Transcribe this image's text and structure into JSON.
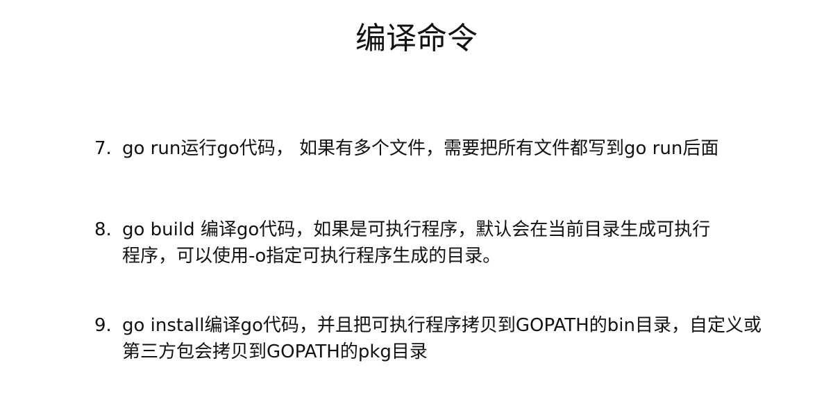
{
  "title": "编译命令",
  "items": [
    {
      "number": "7.",
      "lines": [
        "go run运行go代码， 如果有多个文件，需要把所有文件都写到go run后面"
      ]
    },
    {
      "number": "8.",
      "lines": [
        "go build 编译go代码，如果是可执行程序，默认会在当前目录生成可执行",
        "程序，可以使用-o指定可执行程序生成的目录。"
      ]
    },
    {
      "number": "9.",
      "lines": [
        "go install编译go代码，并且把可执行程序拷贝到GOPATH的bin目录，自定义或",
        "第三方包会拷贝到GOPATH的pkg目录"
      ]
    }
  ]
}
